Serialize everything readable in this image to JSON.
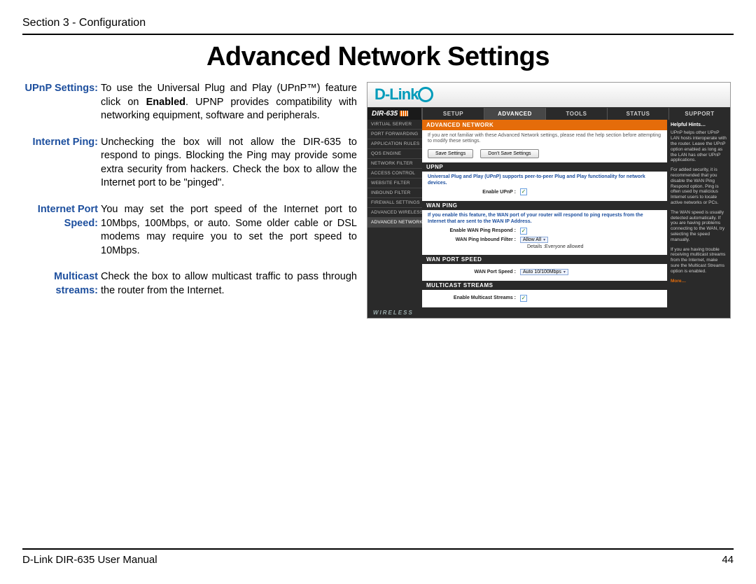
{
  "header": {
    "section": "Section 3 - Configuration"
  },
  "title": "Advanced Network Settings",
  "definitions": [
    {
      "label": "UPnP Settings:",
      "body_html": "To use the Universal Plug and Play (UPnP™) feature click on <b>Enabled</b>. UPNP provides compatibility with networking equipment, software and peripherals."
    },
    {
      "label": "Internet Ping:",
      "body_html": "Unchecking the box will not allow the DIR-635 to respond to pings. Blocking the Ping may provide some extra security from hackers. Check the box to allow the Internet port to be \"pinged\"."
    },
    {
      "label": "Internet Port Speed:",
      "body_html": "You may set the port speed of the Internet port to 10Mbps, 100Mbps, or auto. Some older cable or DSL modems may require you to set the port speed to 10Mbps."
    },
    {
      "label": "Multicast streams:",
      "body_html": "Check the box to allow multicast traffic to pass through the router from the Internet."
    }
  ],
  "router": {
    "brand": "D-Link",
    "model": "DIR-635",
    "topnav": [
      "SETUP",
      "ADVANCED",
      "TOOLS",
      "STATUS",
      "SUPPORT"
    ],
    "topnav_active": 1,
    "sidenav": [
      "VIRTUAL SERVER",
      "PORT FORWARDING",
      "APPLICATION RULES",
      "QOS ENGINE",
      "NETWORK FILTER",
      "ACCESS CONTROL",
      "WEBSITE FILTER",
      "INBOUND FILTER",
      "FIREWALL SETTINGS",
      "ADVANCED WIRELESS",
      "ADVANCED NETWORK"
    ],
    "sidenav_active": 10,
    "page_heading": "ADVANCED NETWORK",
    "intro": "If you are not familiar with these Advanced Network settings, please read the help section before attempting to modify these settings.",
    "buttons": {
      "save": "Save Settings",
      "dont_save": "Don't Save Settings"
    },
    "sections": {
      "upnp": {
        "heading": "UPNP",
        "blurb": "Universal Plug and Play (UPnP) supports peer-to-peer Plug and Play functionality for network devices.",
        "field_label": "Enable UPnP :",
        "checked": true
      },
      "wanping": {
        "heading": "WAN PING",
        "blurb": "If you enable this feature, the WAN port of your router will respond to ping requests from the Internet that are sent to the WAN IP Address.",
        "respond_label": "Enable WAN Ping Respond :",
        "respond_checked": true,
        "filter_label": "WAN Ping Inbound Filter :",
        "filter_value": "Allow All",
        "details_label": "Details :",
        "details_value": "Everyone allowed"
      },
      "portspeed": {
        "heading": "WAN PORT SPEED",
        "field_label": "WAN Port Speed :",
        "value": "Auto 10/100Mbps"
      },
      "multicast": {
        "heading": "MULTICAST STREAMS",
        "field_label": "Enable Multicast Streams :",
        "checked": true
      }
    },
    "help": {
      "heading": "Helpful Hints…",
      "p1": "UPnP helps other UPnP LAN hosts interoperate with the router. Leave the UPnP option enabled as long as the LAN has other UPnP applications.",
      "p2": "For added security, it is recommended that you disable the WAN Ping Respond option. Ping is often used by malicious Internet users to locate active networks or PCs.",
      "p3": "The WAN speed is usually detected automatically. If you are having problems connecting to the WAN, try selecting the speed manually.",
      "p4": "If you are having trouble receiving multicast streams from the Internet, make sure the Multicast Streams option is enabled.",
      "more": "More…"
    },
    "footer": "WIRELESS"
  },
  "footer": {
    "left": "D-Link DIR-635 User Manual",
    "right": "44"
  }
}
